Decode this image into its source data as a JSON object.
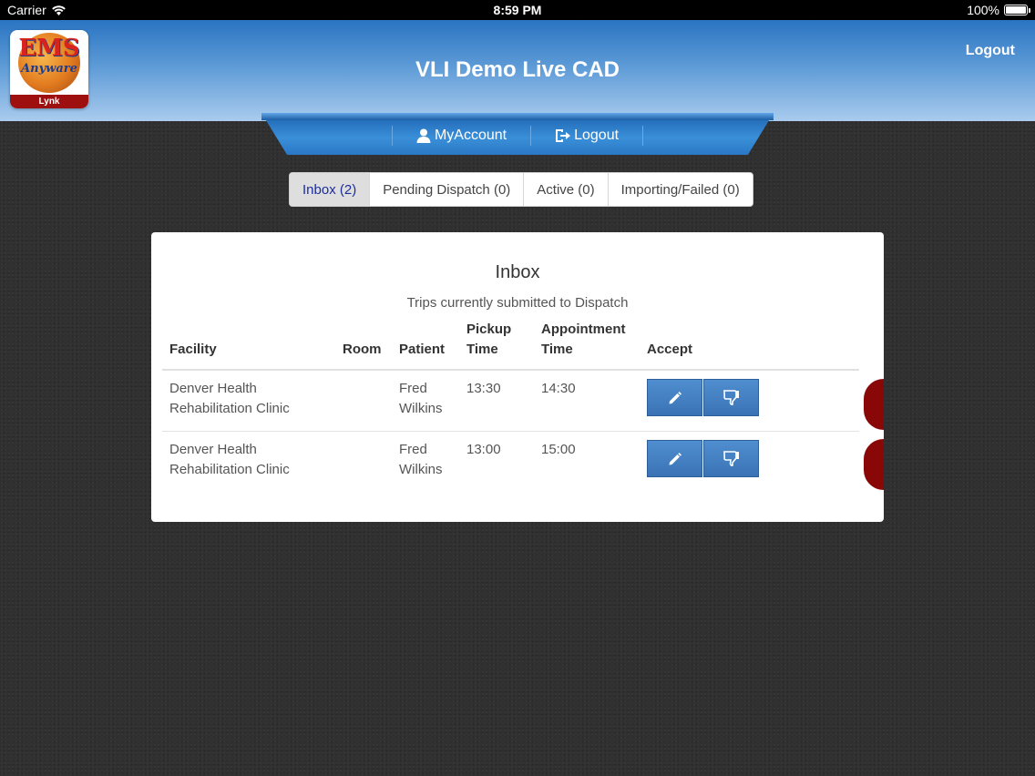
{
  "status_bar": {
    "carrier": "Carrier",
    "time": "8:59 PM",
    "battery": "100%"
  },
  "header": {
    "logo_main": "EMS",
    "logo_sub": "Anyware",
    "logo_badge": "Lynk",
    "title": "VLI Demo Live CAD",
    "logout": "Logout"
  },
  "nav": {
    "my_account": "MyAccount",
    "logout": "Logout"
  },
  "tabs": [
    {
      "label": "Inbox (2)",
      "active": true
    },
    {
      "label": "Pending Dispatch (0)",
      "active": false
    },
    {
      "label": "Active (0)",
      "active": false
    },
    {
      "label": "Importing/Failed (0)",
      "active": false
    }
  ],
  "inbox": {
    "title": "Inbox",
    "subtitle": "Trips currently submitted to Dispatch",
    "columns": {
      "facility": "Facility",
      "room": "Room",
      "patient": "Patient",
      "pickup_1": "Pickup",
      "pickup_2": "Time",
      "appt_1": "Appointment",
      "appt_2": "Time",
      "accept": "Accept"
    },
    "rows": [
      {
        "facility_1": "Denver Health",
        "facility_2": "Rehabilitation Clinic",
        "room": "",
        "patient_1": "Fred",
        "patient_2": "Wilkins",
        "pickup": "13:30",
        "appointment": "14:30"
      },
      {
        "facility_1": "Denver Health",
        "facility_2": "Rehabilitation Clinic",
        "room": "",
        "patient_1": "Fred",
        "patient_2": "Wilkins",
        "pickup": "13:00",
        "appointment": "15:00"
      }
    ]
  },
  "colors": {
    "accent_blue": "#3a73b5",
    "tab_active_text": "#1b2d9b",
    "side_tab": "#8a0707"
  },
  "icons": {
    "edit": "pencil-icon",
    "reject": "thumbs-down-icon",
    "account": "user-icon",
    "logout": "logout-icon",
    "wifi": "wifi-icon",
    "battery": "battery-icon"
  }
}
